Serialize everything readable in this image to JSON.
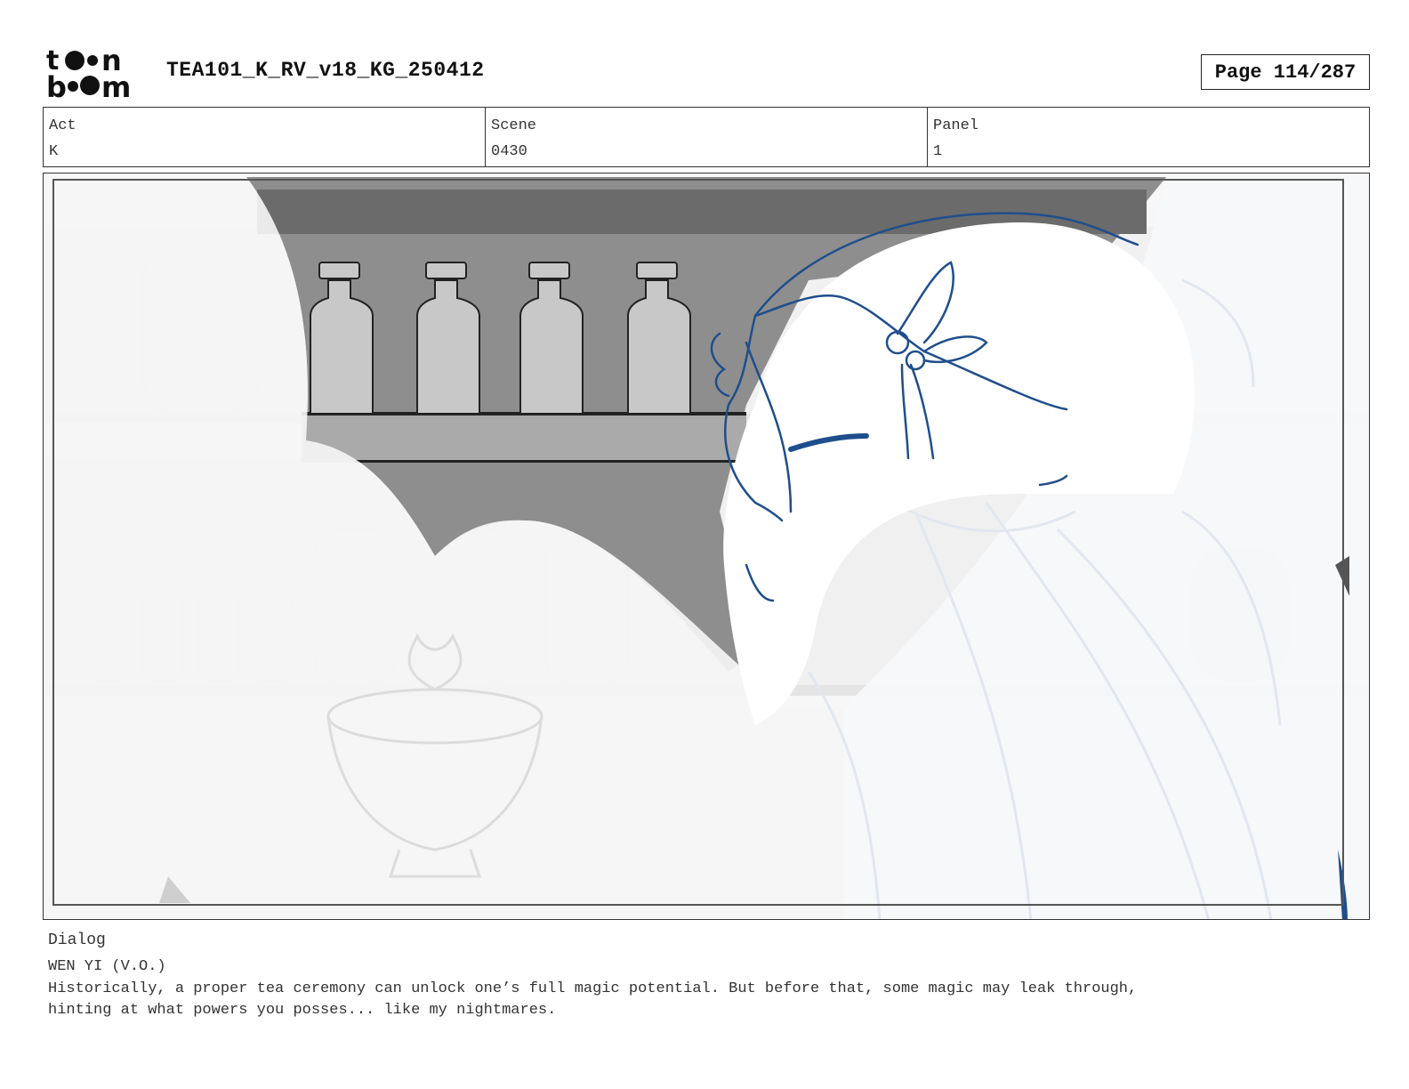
{
  "header": {
    "logo_text": "toon boom",
    "title": "TEA101_K_RV_v18_KG_250412",
    "page_label": "Page 114/287"
  },
  "meta": {
    "act": {
      "label": "Act",
      "value": "K"
    },
    "scene": {
      "label": "Scene",
      "value": "0430"
    },
    "panel": {
      "label": "Panel",
      "value": "1"
    }
  },
  "dialog": {
    "label": "Dialog",
    "speaker": "WEN YI (V.O.)",
    "text": "Historically, a proper tea ceremony can unlock one’s full magic potential. But before that, some magic may leak through,\nhinting at what powers you posses... like my nightmares."
  },
  "colors": {
    "ink_blue": "#1f4e8c",
    "ghost_blue": "#e2e7ef",
    "shelf_dark": "#6b6b6b",
    "shelf_mid": "#8e8e8e",
    "bottle_gray": "#c8c8c8"
  }
}
